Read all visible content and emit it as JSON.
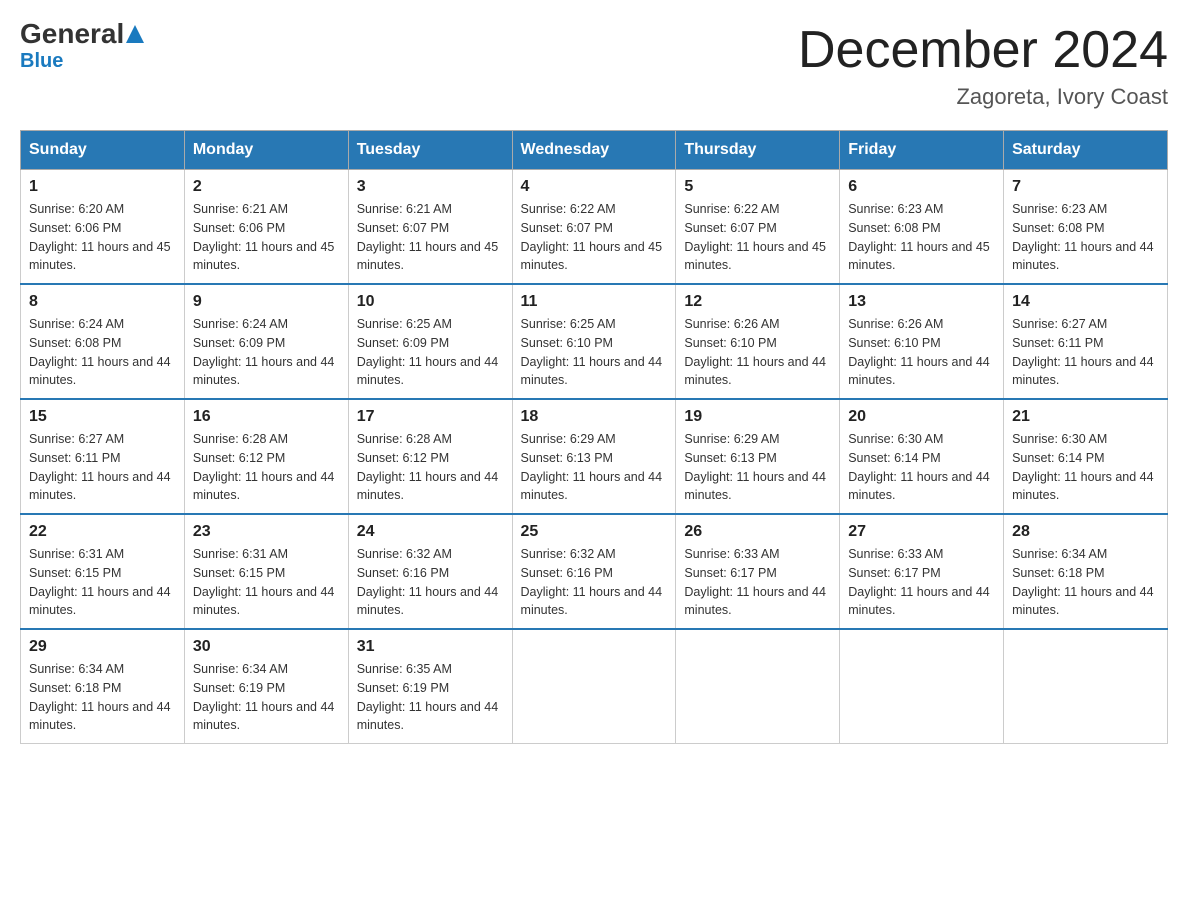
{
  "header": {
    "logo_general": "General",
    "logo_blue": "Blue",
    "title": "December 2024",
    "subtitle": "Zagoreta, Ivory Coast"
  },
  "days_of_week": [
    "Sunday",
    "Monday",
    "Tuesday",
    "Wednesday",
    "Thursday",
    "Friday",
    "Saturday"
  ],
  "weeks": [
    [
      {
        "day": "1",
        "sunrise": "6:20 AM",
        "sunset": "6:06 PM",
        "daylight": "11 hours and 45 minutes."
      },
      {
        "day": "2",
        "sunrise": "6:21 AM",
        "sunset": "6:06 PM",
        "daylight": "11 hours and 45 minutes."
      },
      {
        "day": "3",
        "sunrise": "6:21 AM",
        "sunset": "6:07 PM",
        "daylight": "11 hours and 45 minutes."
      },
      {
        "day": "4",
        "sunrise": "6:22 AM",
        "sunset": "6:07 PM",
        "daylight": "11 hours and 45 minutes."
      },
      {
        "day": "5",
        "sunrise": "6:22 AM",
        "sunset": "6:07 PM",
        "daylight": "11 hours and 45 minutes."
      },
      {
        "day": "6",
        "sunrise": "6:23 AM",
        "sunset": "6:08 PM",
        "daylight": "11 hours and 45 minutes."
      },
      {
        "day": "7",
        "sunrise": "6:23 AM",
        "sunset": "6:08 PM",
        "daylight": "11 hours and 44 minutes."
      }
    ],
    [
      {
        "day": "8",
        "sunrise": "6:24 AM",
        "sunset": "6:08 PM",
        "daylight": "11 hours and 44 minutes."
      },
      {
        "day": "9",
        "sunrise": "6:24 AM",
        "sunset": "6:09 PM",
        "daylight": "11 hours and 44 minutes."
      },
      {
        "day": "10",
        "sunrise": "6:25 AM",
        "sunset": "6:09 PM",
        "daylight": "11 hours and 44 minutes."
      },
      {
        "day": "11",
        "sunrise": "6:25 AM",
        "sunset": "6:10 PM",
        "daylight": "11 hours and 44 minutes."
      },
      {
        "day": "12",
        "sunrise": "6:26 AM",
        "sunset": "6:10 PM",
        "daylight": "11 hours and 44 minutes."
      },
      {
        "day": "13",
        "sunrise": "6:26 AM",
        "sunset": "6:10 PM",
        "daylight": "11 hours and 44 minutes."
      },
      {
        "day": "14",
        "sunrise": "6:27 AM",
        "sunset": "6:11 PM",
        "daylight": "11 hours and 44 minutes."
      }
    ],
    [
      {
        "day": "15",
        "sunrise": "6:27 AM",
        "sunset": "6:11 PM",
        "daylight": "11 hours and 44 minutes."
      },
      {
        "day": "16",
        "sunrise": "6:28 AM",
        "sunset": "6:12 PM",
        "daylight": "11 hours and 44 minutes."
      },
      {
        "day": "17",
        "sunrise": "6:28 AM",
        "sunset": "6:12 PM",
        "daylight": "11 hours and 44 minutes."
      },
      {
        "day": "18",
        "sunrise": "6:29 AM",
        "sunset": "6:13 PM",
        "daylight": "11 hours and 44 minutes."
      },
      {
        "day": "19",
        "sunrise": "6:29 AM",
        "sunset": "6:13 PM",
        "daylight": "11 hours and 44 minutes."
      },
      {
        "day": "20",
        "sunrise": "6:30 AM",
        "sunset": "6:14 PM",
        "daylight": "11 hours and 44 minutes."
      },
      {
        "day": "21",
        "sunrise": "6:30 AM",
        "sunset": "6:14 PM",
        "daylight": "11 hours and 44 minutes."
      }
    ],
    [
      {
        "day": "22",
        "sunrise": "6:31 AM",
        "sunset": "6:15 PM",
        "daylight": "11 hours and 44 minutes."
      },
      {
        "day": "23",
        "sunrise": "6:31 AM",
        "sunset": "6:15 PM",
        "daylight": "11 hours and 44 minutes."
      },
      {
        "day": "24",
        "sunrise": "6:32 AM",
        "sunset": "6:16 PM",
        "daylight": "11 hours and 44 minutes."
      },
      {
        "day": "25",
        "sunrise": "6:32 AM",
        "sunset": "6:16 PM",
        "daylight": "11 hours and 44 minutes."
      },
      {
        "day": "26",
        "sunrise": "6:33 AM",
        "sunset": "6:17 PM",
        "daylight": "11 hours and 44 minutes."
      },
      {
        "day": "27",
        "sunrise": "6:33 AM",
        "sunset": "6:17 PM",
        "daylight": "11 hours and 44 minutes."
      },
      {
        "day": "28",
        "sunrise": "6:34 AM",
        "sunset": "6:18 PM",
        "daylight": "11 hours and 44 minutes."
      }
    ],
    [
      {
        "day": "29",
        "sunrise": "6:34 AM",
        "sunset": "6:18 PM",
        "daylight": "11 hours and 44 minutes."
      },
      {
        "day": "30",
        "sunrise": "6:34 AM",
        "sunset": "6:19 PM",
        "daylight": "11 hours and 44 minutes."
      },
      {
        "day": "31",
        "sunrise": "6:35 AM",
        "sunset": "6:19 PM",
        "daylight": "11 hours and 44 minutes."
      },
      null,
      null,
      null,
      null
    ]
  ]
}
